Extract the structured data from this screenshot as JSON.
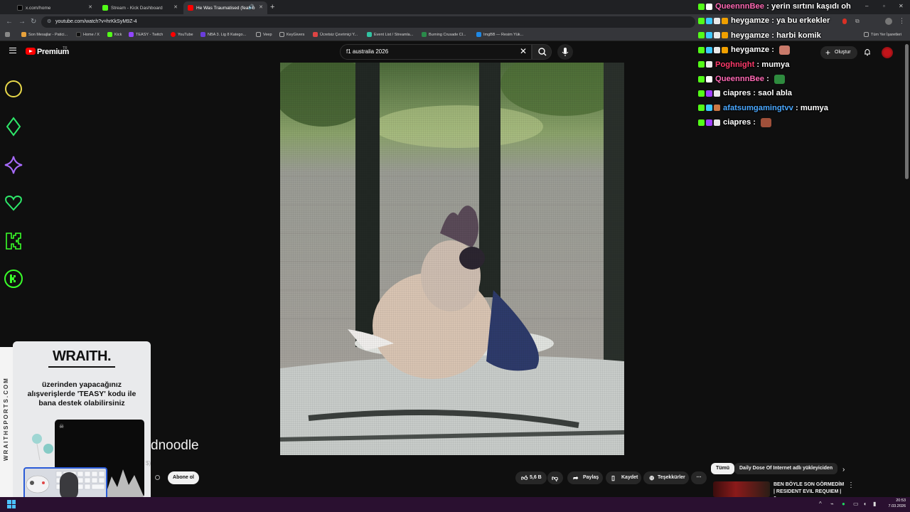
{
  "browser": {
    "tabs": [
      {
        "label": "x.com/home",
        "color": "#000000"
      },
      {
        "label": "Stream - Kick Dashboard",
        "color": "#53fc18"
      },
      {
        "label": "He Was Traumatised (feat. b",
        "color": "#ff0000"
      }
    ],
    "url": "youtube.com/watch?v=hrKkSyM9Z-4",
    "bookmarks": [
      {
        "label": "Son Mesajlar - Patici...",
        "color": "#e8a23c"
      },
      {
        "label": "Home / X",
        "color": "#111111"
      },
      {
        "label": "Kick",
        "color": "#53fc18"
      },
      {
        "label": "TEASY - Twitch",
        "color": "#9146ff"
      },
      {
        "label": "YouTube",
        "color": "#ff0000"
      },
      {
        "label": "NBA 3. Lig 8 Katego...",
        "color": "#6a3ddb"
      },
      {
        "label": "Veep",
        "color": "#888888"
      },
      {
        "label": "KeyGivers",
        "color": "#888888"
      },
      {
        "label": "Ücretsiz Çevrimiçi Y...",
        "color": "#d44"
      },
      {
        "label": "Event List / Streamla...",
        "color": "#31c3a2"
      },
      {
        "label": "Burning Crusade Cl...",
        "color": "#2a8a4a"
      },
      {
        "label": "ImgBB — Resim Yük...",
        "color": "#1e88e5"
      }
    ],
    "all_bookmarks": "Tüm Yer İşaretleri"
  },
  "youtube": {
    "logo_text": "Premium",
    "region": "TR",
    "search_query": "f1 australia 2026",
    "create_label": "Oluştur",
    "channel_name_partial": "dnoodle",
    "sub_count_partial": "$)",
    "subscribe_label": "Abone ol",
    "likes": "5,6 B",
    "share_label": "Paylaş",
    "save_label": "Kaydet",
    "thanks_label": "Teşekkürler",
    "chips": [
      "Tümü",
      "Daily Dose Of Internet adlı yükleyiciden"
    ],
    "recommendation_title": "BEN BÖYLE SON GÖRMEDİM | RESIDENT EVIL REQUIEM | 6. ...",
    "accent": "#ff0000"
  },
  "chat": [
    {
      "user": "QueennnBee",
      "message": "yerin sırtını kaşıdı oh",
      "color": "#ff69b4"
    },
    {
      "user": "heygamze",
      "message": "ya bu erkekler",
      "color": "#ffffff"
    },
    {
      "user": "heygamze",
      "message": "harbi komik",
      "color": "#ffffff"
    },
    {
      "user": "heygamze",
      "message": "",
      "color": "#ffffff",
      "emote": "#c97a6a"
    },
    {
      "user": "Poghnight",
      "message": "mumya",
      "color": "#ff3b6b"
    },
    {
      "user": "QueennnBee",
      "message": "",
      "color": "#ff69b4",
      "emote": "#2e8b3e"
    },
    {
      "user": "ciapres",
      "message": "saol abla",
      "color": "#ffffff"
    },
    {
      "user": "afatsumgamingtvv",
      "message": "mumya",
      "color": "#4aa8ff"
    },
    {
      "user": "ciapres",
      "message": "",
      "color": "#ffffff",
      "emote": "#a0503a"
    }
  ],
  "sponsor": {
    "brand": "WRAITH.",
    "text": "üzerinden yapacağınız alışverişlerde 'TEASY' kodu ile bana destek olabilirsiniz",
    "strip_text": "WRAITHSPORTS.COM"
  },
  "taskbar": {
    "time": "20:53",
    "date": "7.03.2026"
  }
}
